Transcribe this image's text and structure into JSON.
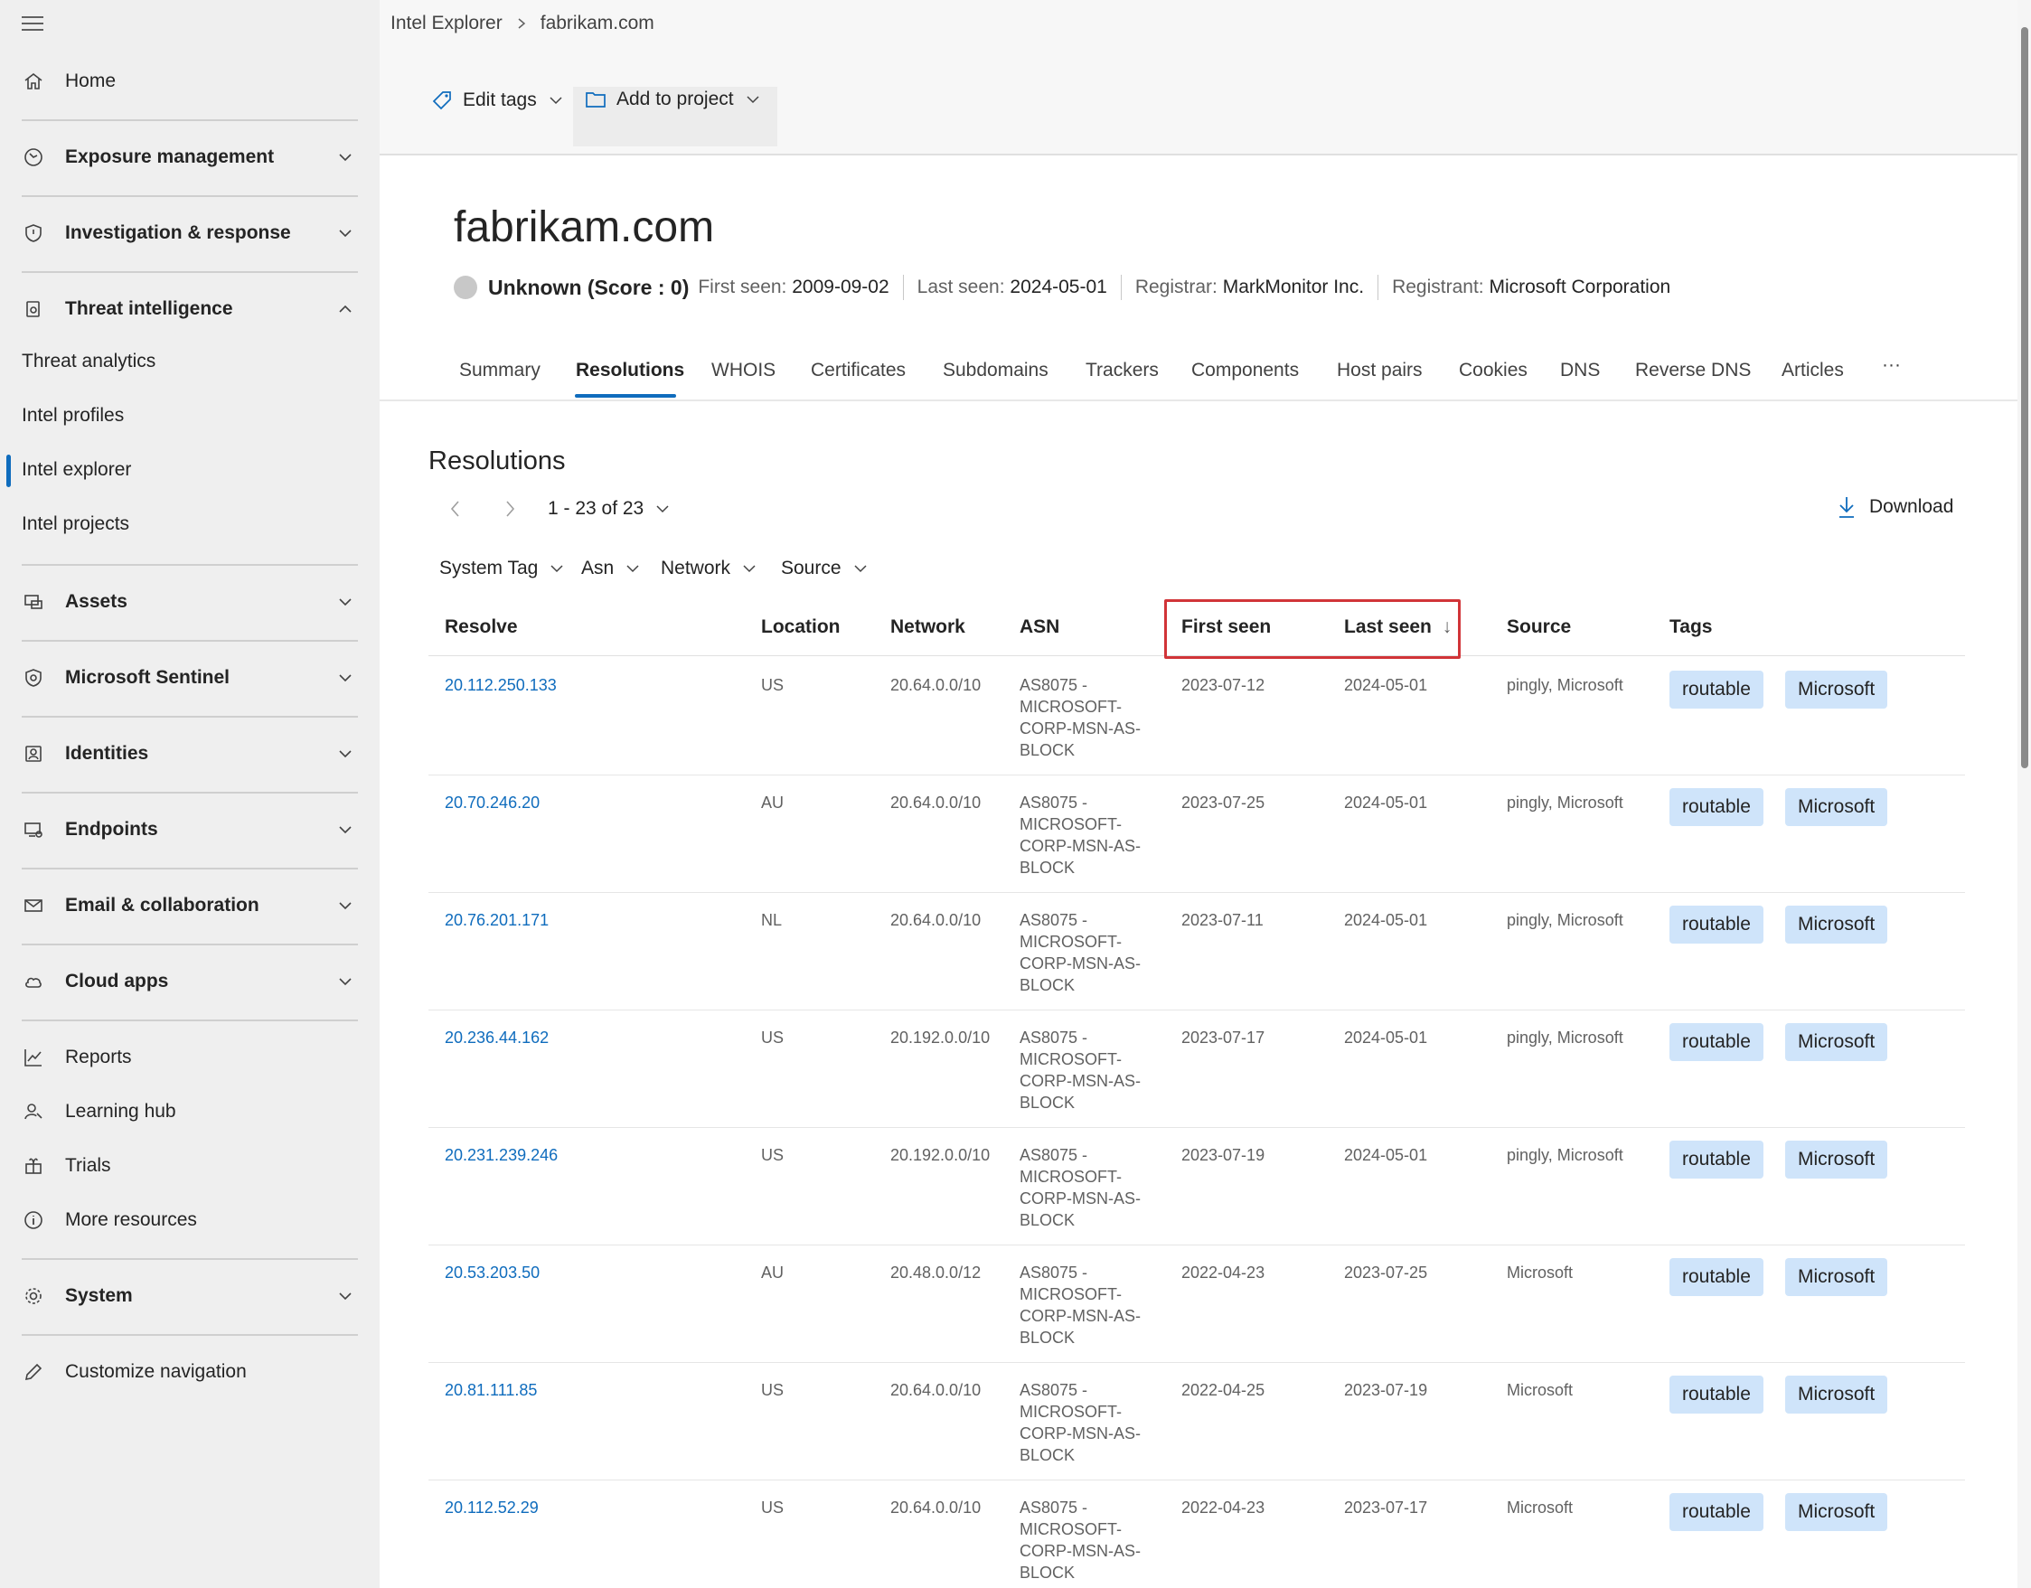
{
  "sidebar": {
    "items": [
      {
        "label": "Home",
        "icon": "home-icon",
        "bold": false,
        "expand": false
      },
      {
        "label": "Exposure management",
        "icon": "exposure-icon",
        "bold": true,
        "expand": true
      },
      {
        "label": "Investigation & response",
        "icon": "shield-icon",
        "bold": true,
        "expand": true
      },
      {
        "label": "Threat intelligence",
        "icon": "threat-intel-icon",
        "bold": true,
        "expand": "up"
      },
      {
        "label": "Assets",
        "icon": "assets-icon",
        "bold": true,
        "expand": true
      },
      {
        "label": "Microsoft Sentinel",
        "icon": "sentinel-icon",
        "bold": true,
        "expand": true
      },
      {
        "label": "Identities",
        "icon": "identities-icon",
        "bold": true,
        "expand": true
      },
      {
        "label": "Endpoints",
        "icon": "endpoints-icon",
        "bold": true,
        "expand": true
      },
      {
        "label": "Email & collaboration",
        "icon": "mail-icon",
        "bold": true,
        "expand": true
      },
      {
        "label": "Cloud apps",
        "icon": "cloud-icon",
        "bold": true,
        "expand": true
      },
      {
        "label": "Reports",
        "icon": "reports-icon",
        "bold": false,
        "expand": false
      },
      {
        "label": "Learning hub",
        "icon": "learning-icon",
        "bold": false,
        "expand": false
      },
      {
        "label": "Trials",
        "icon": "trials-icon",
        "bold": false,
        "expand": false
      },
      {
        "label": "More resources",
        "icon": "info-icon",
        "bold": false,
        "expand": false
      },
      {
        "label": "System",
        "icon": "gear-icon",
        "bold": true,
        "expand": true
      },
      {
        "label": "Customize navigation",
        "icon": "pencil-icon",
        "bold": false,
        "expand": false
      }
    ],
    "sub_items": [
      "Threat analytics",
      "Intel profiles",
      "Intel explorer",
      "Intel projects"
    ],
    "active_sub": "Intel explorer"
  },
  "breadcrumb": {
    "root": "Intel Explorer",
    "current": "fabrikam.com"
  },
  "commands": {
    "edit_tags": "Edit tags",
    "add_to_project": "Add to project"
  },
  "entity": {
    "title": "fabrikam.com",
    "score": "Unknown (Score : 0)",
    "first_seen_label": "First seen:",
    "first_seen": "2009-09-02",
    "last_seen_label": "Last seen:",
    "last_seen": "2024-05-01",
    "registrar_label": "Registrar:",
    "registrar": "MarkMonitor Inc.",
    "registrant_label": "Registrant:",
    "registrant": "Microsoft Corporation"
  },
  "tabs": [
    "Summary",
    "Resolutions",
    "WHOIS",
    "Certificates",
    "Subdomains",
    "Trackers",
    "Components",
    "Host pairs",
    "Cookies",
    "DNS",
    "Reverse DNS",
    "Articles",
    "···"
  ],
  "active_tab": "Resolutions",
  "section": {
    "title": "Resolutions",
    "pager": "1 - 23 of 23",
    "download": "Download",
    "filters": [
      "System Tag",
      "Asn",
      "Network",
      "Source"
    ]
  },
  "table": {
    "columns": [
      "Resolve",
      "Location",
      "Network",
      "ASN",
      "First seen",
      "Last seen",
      "Source",
      "Tags"
    ],
    "sort_indicator": "↓",
    "rows": [
      {
        "resolve": "20.112.250.133",
        "location": "US",
        "network": "20.64.0.0/10",
        "asn": "AS8075 - MICROSOFT- CORP-MSN-AS- BLOCK",
        "first": "2023-07-12",
        "last": "2024-05-01",
        "source": "pingly, Microsoft",
        "tags": [
          "routable",
          "Microsoft"
        ]
      },
      {
        "resolve": "20.70.246.20",
        "location": "AU",
        "network": "20.64.0.0/10",
        "asn": "AS8075 - MICROSOFT- CORP-MSN-AS- BLOCK",
        "first": "2023-07-25",
        "last": "2024-05-01",
        "source": "pingly, Microsoft",
        "tags": [
          "routable",
          "Microsoft"
        ]
      },
      {
        "resolve": "20.76.201.171",
        "location": "NL",
        "network": "20.64.0.0/10",
        "asn": "AS8075 - MICROSOFT- CORP-MSN-AS- BLOCK",
        "first": "2023-07-11",
        "last": "2024-05-01",
        "source": "pingly, Microsoft",
        "tags": [
          "routable",
          "Microsoft"
        ]
      },
      {
        "resolve": "20.236.44.162",
        "location": "US",
        "network": "20.192.0.0/10",
        "asn": "AS8075 - MICROSOFT- CORP-MSN-AS- BLOCK",
        "first": "2023-07-17",
        "last": "2024-05-01",
        "source": "pingly, Microsoft",
        "tags": [
          "routable",
          "Microsoft"
        ]
      },
      {
        "resolve": "20.231.239.246",
        "location": "US",
        "network": "20.192.0.0/10",
        "asn": "AS8075 - MICROSOFT- CORP-MSN-AS- BLOCK",
        "first": "2023-07-19",
        "last": "2024-05-01",
        "source": "pingly, Microsoft",
        "tags": [
          "routable",
          "Microsoft"
        ]
      },
      {
        "resolve": "20.53.203.50",
        "location": "AU",
        "network": "20.48.0.0/12",
        "asn": "AS8075 - MICROSOFT- CORP-MSN-AS- BLOCK",
        "first": "2022-04-23",
        "last": "2023-07-25",
        "source": "Microsoft",
        "tags": [
          "routable",
          "Microsoft"
        ]
      },
      {
        "resolve": "20.81.111.85",
        "location": "US",
        "network": "20.64.0.0/10",
        "asn": "AS8075 - MICROSOFT- CORP-MSN-AS- BLOCK",
        "first": "2022-04-25",
        "last": "2023-07-19",
        "source": "Microsoft",
        "tags": [
          "routable",
          "Microsoft"
        ]
      },
      {
        "resolve": "20.112.52.29",
        "location": "US",
        "network": "20.64.0.0/10",
        "asn": "AS8075 - MICROSOFT- CORP-MSN-AS- BLOCK",
        "first": "2022-04-23",
        "last": "2023-07-17",
        "source": "Microsoft",
        "tags": [
          "routable",
          "Microsoft"
        ]
      }
    ]
  },
  "colors": {
    "accent": "#0f6cbd",
    "tag_bg": "#cfe4fa",
    "highlight": "#d13438"
  }
}
